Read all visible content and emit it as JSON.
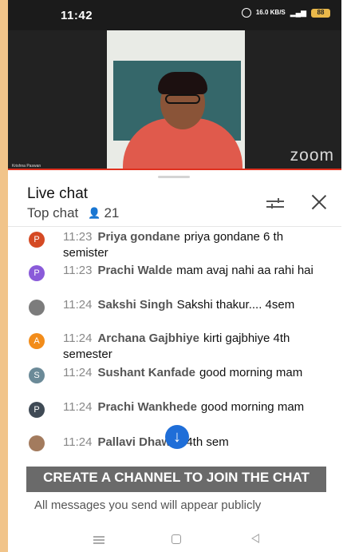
{
  "status_bar": {
    "time": "11:42",
    "network_speed": "16.0 KB/S",
    "battery": "88"
  },
  "video": {
    "logo": "zoom",
    "caption": "Krishna Paswan"
  },
  "chat": {
    "title": "Live chat",
    "filter_label": "Top chat",
    "viewer_count": "21",
    "messages": [
      {
        "avatar_letter": "P",
        "avatar_color": "#d54a24",
        "time": "11:23",
        "author": "Priya gondane",
        "text": "priya gondane 6 th semister"
      },
      {
        "avatar_letter": "P",
        "avatar_color": "#8a5bd9",
        "time": "11:23",
        "author": "Prachi Walde",
        "text": "mam avaj nahi aa rahi hai"
      },
      {
        "avatar_letter": "",
        "avatar_color": "#7c7c7c",
        "time": "11:24",
        "author": "Sakshi Singh",
        "text": "Sakshi thakur.... 4sem"
      },
      {
        "avatar_letter": "A",
        "avatar_color": "#f28c1a",
        "time": "11:24",
        "author": "Archana Gajbhiye",
        "text": "kirti gajbhiye 4th semester"
      },
      {
        "avatar_letter": "S",
        "avatar_color": "#6b8a98",
        "time": "11:24",
        "author": "Sushant Kanfade",
        "text": "good morning mam"
      },
      {
        "avatar_letter": "P",
        "avatar_color": "#3f4a55",
        "time": "11:24",
        "author": "Prachi Wankhede",
        "text": "good morning mam"
      },
      {
        "avatar_letter": "",
        "avatar_color": "#a37b5e",
        "time": "11:24",
        "author": "Pallavi Dhawar",
        "text": "4th sem"
      }
    ]
  },
  "footer": {
    "create_channel_label": "CREATE A CHANNEL TO JOIN THE CHAT",
    "public_note": "All messages you send will appear publicly"
  },
  "icons": {
    "scroll_down": "arrow-down-icon",
    "filter": "filter-icon",
    "close": "close-icon"
  },
  "colors": {
    "accent_blue": "#1f6ed8",
    "accent_red": "#e0301e"
  }
}
